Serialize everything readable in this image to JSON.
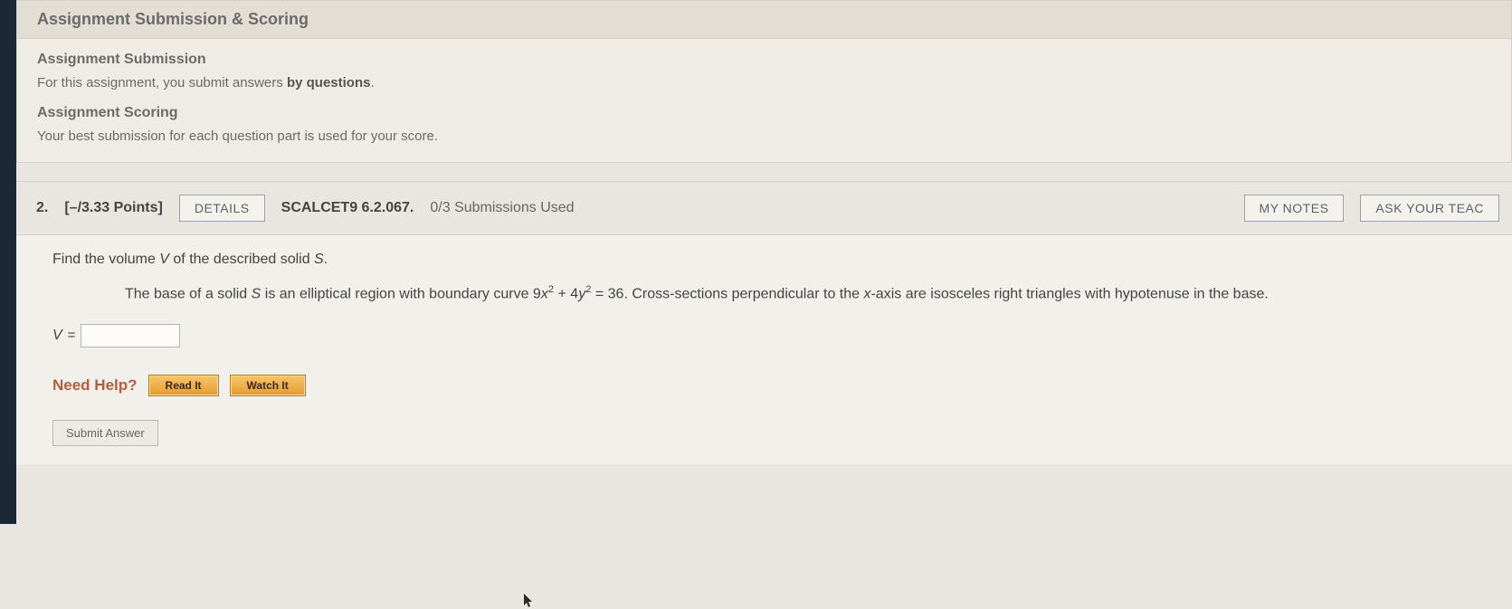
{
  "info": {
    "title": "Assignment Submission & Scoring",
    "submission_head": "Assignment Submission",
    "submission_text_pre": "For this assignment, you submit answers ",
    "submission_text_bold": "by questions",
    "submission_text_post": ".",
    "scoring_head": "Assignment Scoring",
    "scoring_text": "Your best submission for each question part is used for your score."
  },
  "question": {
    "number": "2.",
    "points": "[–/3.33 Points]",
    "details_label": "DETAILS",
    "ref": "SCALCET9 6.2.067.",
    "subs_used": "0/3 Submissions Used",
    "my_notes_label": "MY NOTES",
    "ask_teacher_label": "ASK YOUR TEAC",
    "prompt_pre": "Find the volume ",
    "prompt_v": "V",
    "prompt_mid": " of the described solid ",
    "prompt_s": "S",
    "prompt_post": ".",
    "desc_pre": "The base of a solid ",
    "desc_s": "S",
    "desc_mid1": " is an elliptical region with boundary curve 9",
    "desc_x": "x",
    "desc_sq1": "2",
    "desc_plus": " + 4",
    "desc_y": "y",
    "desc_sq2": "2",
    "desc_eq": " = 36. Cross-sections perpendicular to the ",
    "desc_xaxis": "x",
    "desc_end": "-axis are isosceles right triangles with hypotenuse in the base.",
    "answer_var": "V",
    "answer_eq": " = ",
    "answer_value": ""
  },
  "help": {
    "label": "Need Help?",
    "read": "Read It",
    "watch": "Watch It"
  },
  "submit": {
    "label": "Submit Answer"
  }
}
